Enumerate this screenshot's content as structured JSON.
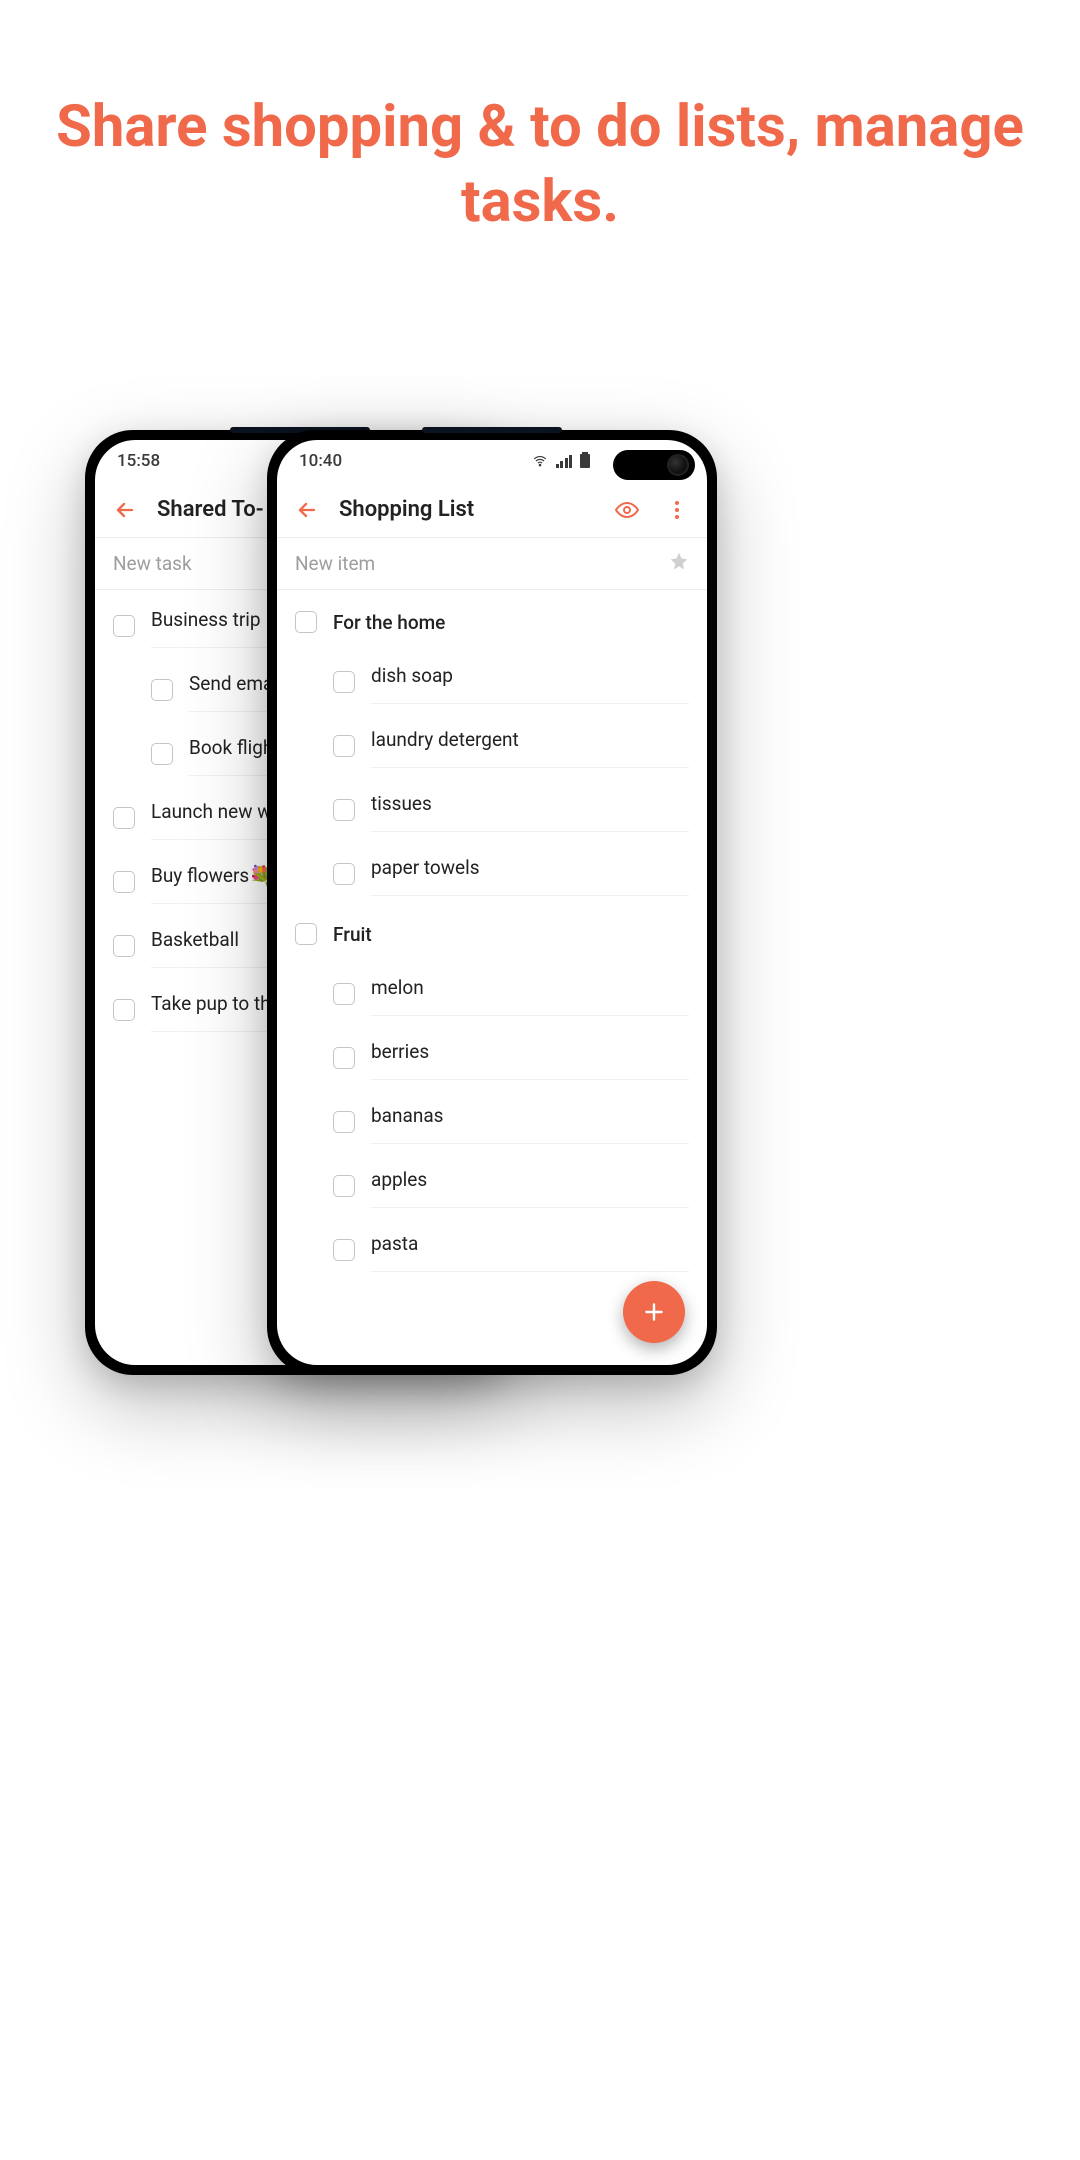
{
  "headline": "Share shopping & to do lists, manage tasks.",
  "accent": "#f0694b",
  "backPhone": {
    "time": "15:58",
    "title": "Shared To-",
    "newPlaceholder": "New task",
    "items": [
      {
        "label": "Business trip",
        "sub": false
      },
      {
        "label": "Send email",
        "sub": true
      },
      {
        "label": "Book flight",
        "sub": true
      },
      {
        "label": "Launch new we",
        "sub": false
      },
      {
        "label": "Buy flowers💐",
        "sub": false
      },
      {
        "label": "Basketball",
        "sub": false
      },
      {
        "label": "Take pup to the",
        "sub": false
      }
    ]
  },
  "frontPhone": {
    "time": "10:40",
    "title": "Shopping List",
    "newPlaceholder": "New item",
    "groups": [
      {
        "header": "For the home",
        "items": [
          "dish soap",
          "laundry detergent",
          "tissues",
          "paper towels"
        ]
      },
      {
        "header": "Fruit",
        "items": [
          " melon",
          "berries",
          "bananas",
          "apples",
          "pasta"
        ]
      }
    ]
  }
}
